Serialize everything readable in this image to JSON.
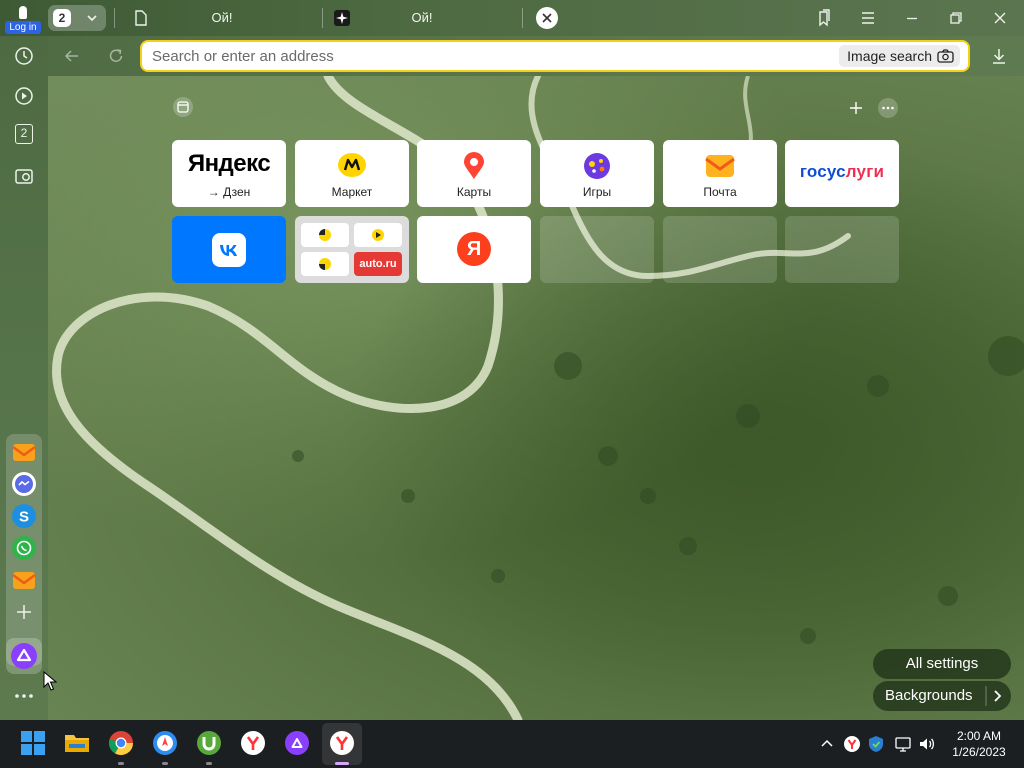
{
  "titlebar": {
    "login_label": "Log in",
    "tab_count": "2",
    "tabs": [
      {
        "title": "Ой!",
        "icon": "document-icon"
      },
      {
        "title": "Ой!",
        "icon": "sparkle-icon"
      }
    ]
  },
  "sidebar": {
    "tab_count": "2",
    "messengers": [
      "mail-icon",
      "messenger-icon",
      "skype-icon",
      "whatsapp-icon",
      "mail-icon"
    ]
  },
  "address_bar": {
    "placeholder": "Search or enter an address",
    "value": "",
    "image_search_label": "Image search"
  },
  "speed_dial": {
    "row1": [
      {
        "title": "Яндекс",
        "label": "→ Дзен"
      },
      {
        "title": "",
        "label": "Маркет"
      },
      {
        "title": "",
        "label": "Карты"
      },
      {
        "title": "",
        "label": "Игры"
      },
      {
        "title": "",
        "label": "Почта"
      },
      {
        "title": "госуслуги",
        "label": ""
      }
    ],
    "row2": [
      {
        "title": "VK",
        "label": ""
      },
      {
        "title": "auto.ru",
        "label": ""
      },
      {
        "title": "Я",
        "label": ""
      }
    ]
  },
  "bottom_buttons": {
    "all_settings": "All settings",
    "backgrounds": "Backgrounds"
  },
  "taskbar": {
    "time": "2:00 AM",
    "date": "1/26/2023"
  },
  "colors": {
    "accent_yellow": "#f6cf16",
    "vk_blue": "#0077ff",
    "yandex_red": "#fc3f1d",
    "alice_purple": "#8a3ffc"
  }
}
